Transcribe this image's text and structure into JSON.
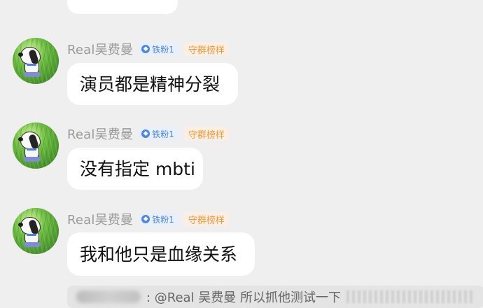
{
  "chat": {
    "messages": [
      {
        "name": "Real吴费曼",
        "fan_badge": "铁粉1",
        "title_badge": "守群榜样",
        "text": "演员都是精神分裂"
      },
      {
        "name": "Real吴费曼",
        "fan_badge": "铁粉1",
        "title_badge": "守群榜样",
        "text": "没有指定 mbti"
      },
      {
        "name": "Real吴费曼",
        "fan_badge": "铁粉1",
        "title_badge": "守群榜样",
        "text": "我和他只是血缘关系"
      }
    ],
    "quoted_reply": {
      "text": ": @Real 吴费曼 所以抓他测试一下"
    }
  }
}
